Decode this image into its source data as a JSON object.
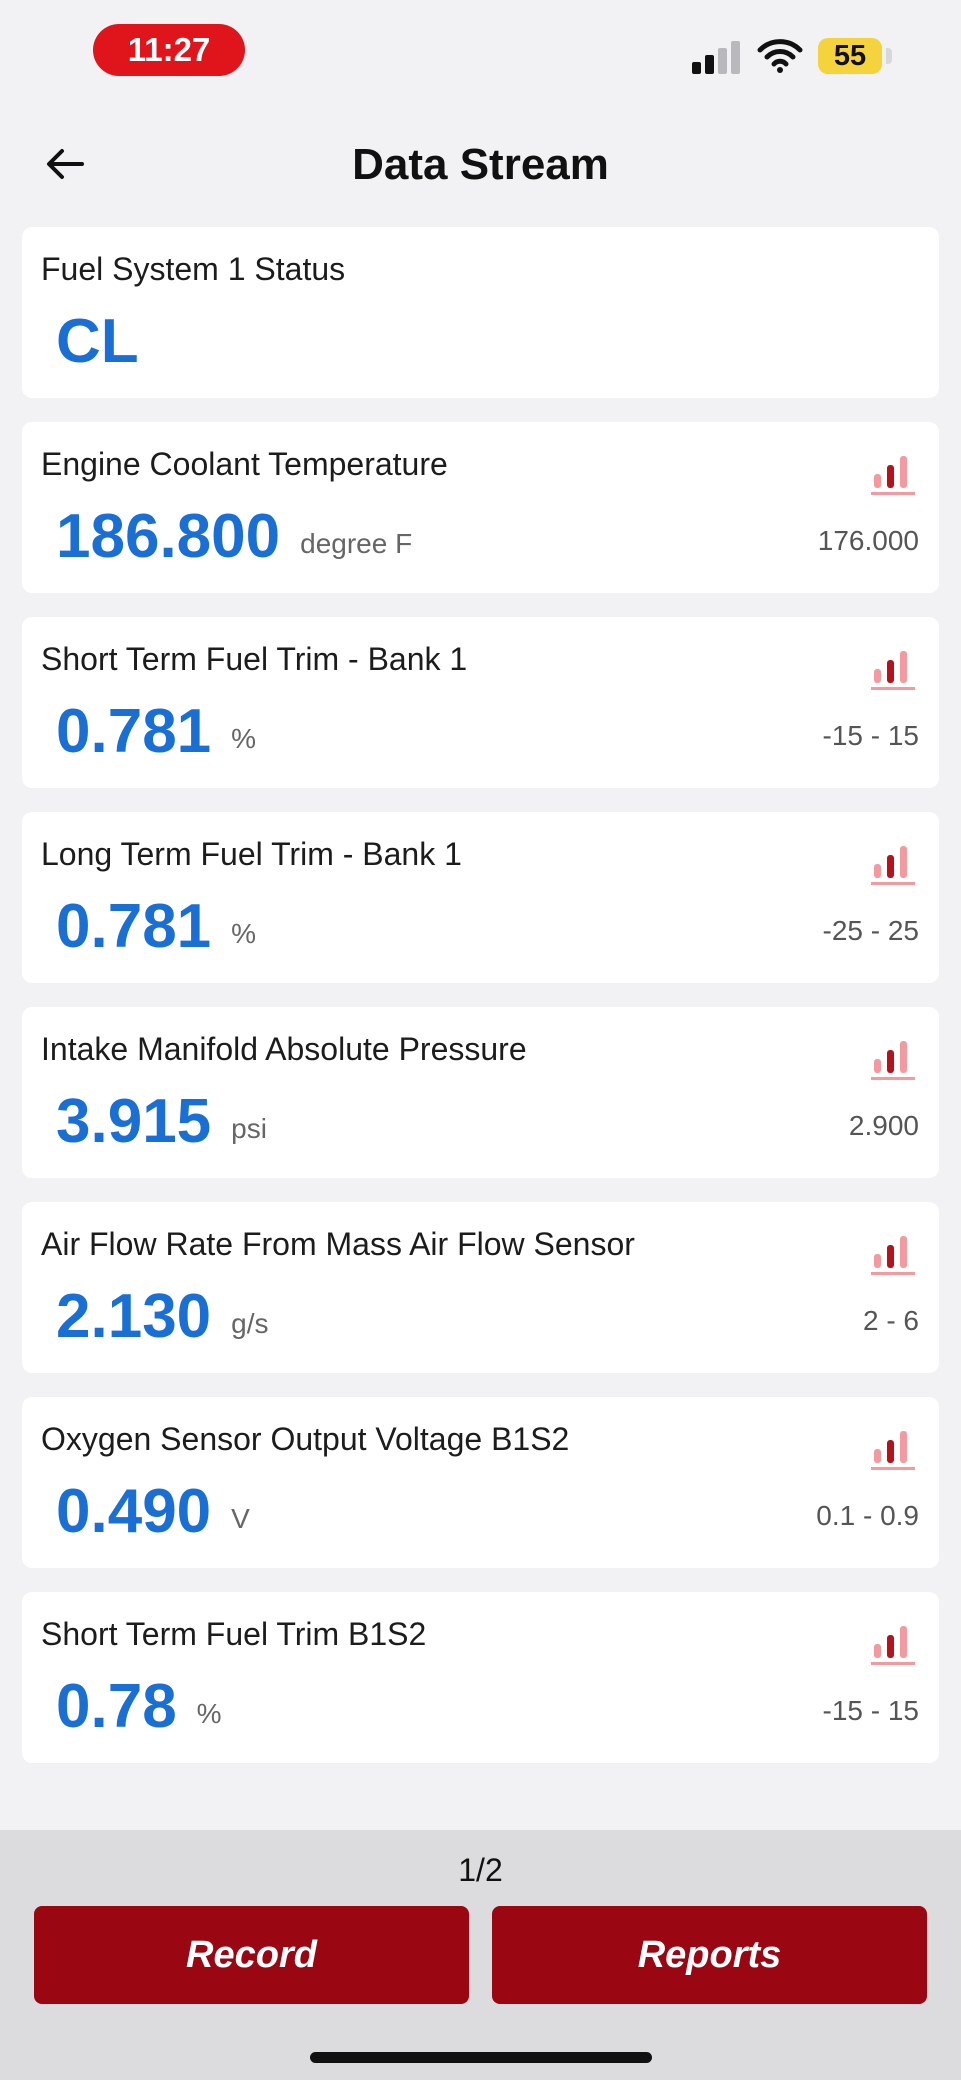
{
  "status_bar": {
    "time": "11:27",
    "battery": "55"
  },
  "nav": {
    "title": "Data Stream"
  },
  "colors": {
    "value_blue": "#1a6fd4",
    "accent_red": "#9a0612",
    "time_pill_red": "#e0151c",
    "battery_yellow": "#f5d33c",
    "graph_icon_dark": "#b5121b",
    "graph_icon_light": "#f29aa0"
  },
  "icons": [
    "back-arrow-icon",
    "graph-icon",
    "signal-icon",
    "wifi-icon",
    "battery-icon"
  ],
  "items": [
    {
      "name": "Fuel System 1 Status",
      "value": "CL",
      "unit": "",
      "range": "",
      "has_graph": false
    },
    {
      "name": "Engine Coolant Temperature",
      "value": "186.800",
      "unit": "degree F",
      "range": "176.000",
      "has_graph": true
    },
    {
      "name": "Short Term Fuel Trim - Bank 1",
      "value": "0.781",
      "unit": "%",
      "range": "-15 - 15",
      "has_graph": true
    },
    {
      "name": "Long Term Fuel Trim - Bank 1",
      "value": "0.781",
      "unit": "%",
      "range": "-25 - 25",
      "has_graph": true
    },
    {
      "name": "Intake Manifold Absolute Pressure",
      "value": "3.915",
      "unit": "psi",
      "range": "2.900",
      "has_graph": true
    },
    {
      "name": "Air Flow Rate From Mass Air Flow Sensor",
      "value": "2.130",
      "unit": "g/s",
      "range": "2 - 6",
      "has_graph": true
    },
    {
      "name": "Oxygen Sensor Output Voltage B1S2",
      "value": "0.490",
      "unit": "V",
      "range": "0.1 - 0.9",
      "has_graph": true
    },
    {
      "name": "Short Term Fuel Trim B1S2",
      "value": "0.78",
      "unit": "%",
      "range": "-15 - 15",
      "has_graph": true
    }
  ],
  "footer": {
    "page_indicator": "1/2",
    "record_label": "Record",
    "reports_label": "Reports"
  }
}
